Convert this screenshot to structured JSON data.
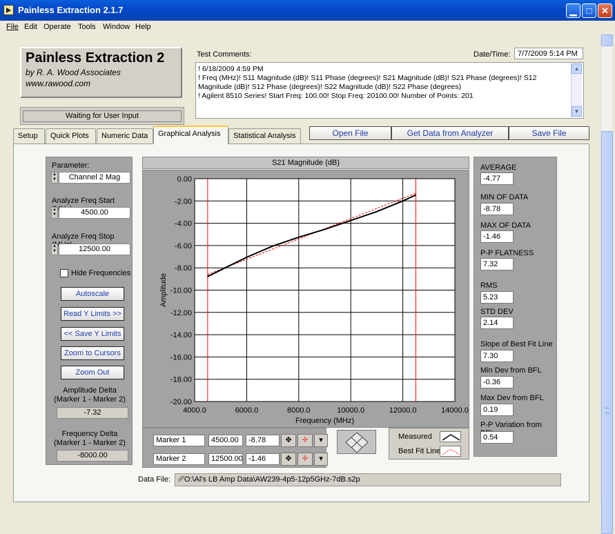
{
  "window": {
    "title": "Painless Extraction 2.1.7",
    "min": "▁",
    "max": "□",
    "close": "✕"
  },
  "menu": [
    "File",
    "Edit",
    "Operate",
    "Tools",
    "Window",
    "Help"
  ],
  "logo": {
    "title": "Painless Extraction 2",
    "by": "by R. A. Wood Associates",
    "url": "www.rawood.com"
  },
  "status": "Waiting for User Input",
  "comments": {
    "label": "Test Comments:",
    "lines": [
      "! 6/18/2009 4:59 PM",
      "! Freq (MHz)! S11 Magnitude (dB)! S11 Phase (degrees)! S21 Magnitude (dB)! S21 Phase (degrees)! S12 Magnitude (dB)! S12 Phase (degrees)! S22 Magnitude (dB)! S22 Phase (degrees)",
      "! Agilent 8510 Series! Start Freq: 100.00! Stop Freq: 20100.00! Number of Points: 201"
    ]
  },
  "datetime": {
    "label": "Date/Time:",
    "value": "7/7/2009  5:14 PM"
  },
  "tabs": [
    "Setup",
    "Quick Plots",
    "Numeric Data",
    "Graphical Analysis",
    "Statistical Analysis"
  ],
  "actions": {
    "open": "Open File",
    "get": "Get Data from Analyzer",
    "save": "Save File"
  },
  "left": {
    "param_label": "Parameter:",
    "param_value": "Channel 2 Mag",
    "start_label": "Analyze Freq Start (MHz)",
    "start_value": "4500.00",
    "stop_label": "Analyze Freq Stop (MHz)",
    "stop_value": "12500.00",
    "hide_label": "Hide Frequencies",
    "autoscale": "Autoscale",
    "read_y": "Read Y Limits >>",
    "save_y": "<< Save Y Limits",
    "zoom_cursors": "Zoom to Cursors",
    "zoom_out": "Zoom Out",
    "amp_delta_label1": "Amplitude Delta",
    "amp_delta_label2": "(Marker 1 - Marker 2)",
    "amp_delta_value": "-7.32",
    "freq_delta_label1": "Frequency Delta",
    "freq_delta_label2": "(Marker 1 - Marker 2)",
    "freq_delta_value": "-8000.00"
  },
  "stats": [
    {
      "label": "AVERAGE",
      "value": "-4.77"
    },
    {
      "label": "MIN OF DATA",
      "value": "-8.78"
    },
    {
      "label": "MAX OF DATA",
      "value": "-1.46"
    },
    {
      "label": "P-P FLATNESS",
      "value": "7.32"
    },
    {
      "label": "RMS",
      "value": "5.23"
    },
    {
      "label": "STD DEV",
      "value": "2.14"
    },
    {
      "label": "Slope of Best Fit Line",
      "value": "7.30"
    },
    {
      "label": "Min Dev from BFL",
      "value": "-0.36"
    },
    {
      "label": "Max Dev from BFL",
      "value": "0.19"
    },
    {
      "label": "P-P Variation from BFL",
      "value": "0.54"
    }
  ],
  "markers": [
    {
      "name": "Marker 1",
      "freq": "4500.00",
      "amp": "-8.78"
    },
    {
      "name": "Marker 2",
      "freq": "12500.00",
      "amp": "-1.46"
    }
  ],
  "legend": {
    "measured": "Measured",
    "bestfit": "Best Fit Line"
  },
  "datafile": {
    "label": "Data File:",
    "path": "O:\\Al's LB Amp Data\\AW239-4p5-12p5GHz-7dB.s2p"
  },
  "colors": {
    "measured": "#000000",
    "bestfit": "#FF0000",
    "marker": "#FF0000",
    "titlebar": "#0A5FDB"
  },
  "chart_data": {
    "type": "line",
    "title": "S21 Magnitude (dB)",
    "xlabel": "Frequency (MHz)",
    "ylabel": "Amplitude",
    "xlim": [
      4000,
      14000
    ],
    "ylim": [
      -20,
      0
    ],
    "grid": true,
    "xticks": [
      "4000.0",
      "6000.0",
      "8000.0",
      "10000.0",
      "12000.0",
      "14000.0"
    ],
    "yticks": [
      "0.00",
      "-2.00",
      "-4.00",
      "-6.00",
      "-8.00",
      "-10.00",
      "-12.00",
      "-14.00",
      "-16.00",
      "-18.00",
      "-20.00"
    ],
    "markers_x": [
      4500,
      12500
    ],
    "series": [
      {
        "name": "Measured",
        "x": [
          4500,
          5000,
          6000,
          7000,
          8000,
          9000,
          10000,
          11000,
          12000,
          12500
        ],
        "y": [
          -8.78,
          -8.2,
          -7.05,
          -6.05,
          -5.25,
          -4.55,
          -3.75,
          -2.95,
          -2.0,
          -1.46
        ]
      },
      {
        "name": "Best Fit Line",
        "x": [
          4500,
          12500
        ],
        "y": [
          -8.6,
          -1.3
        ]
      }
    ]
  }
}
